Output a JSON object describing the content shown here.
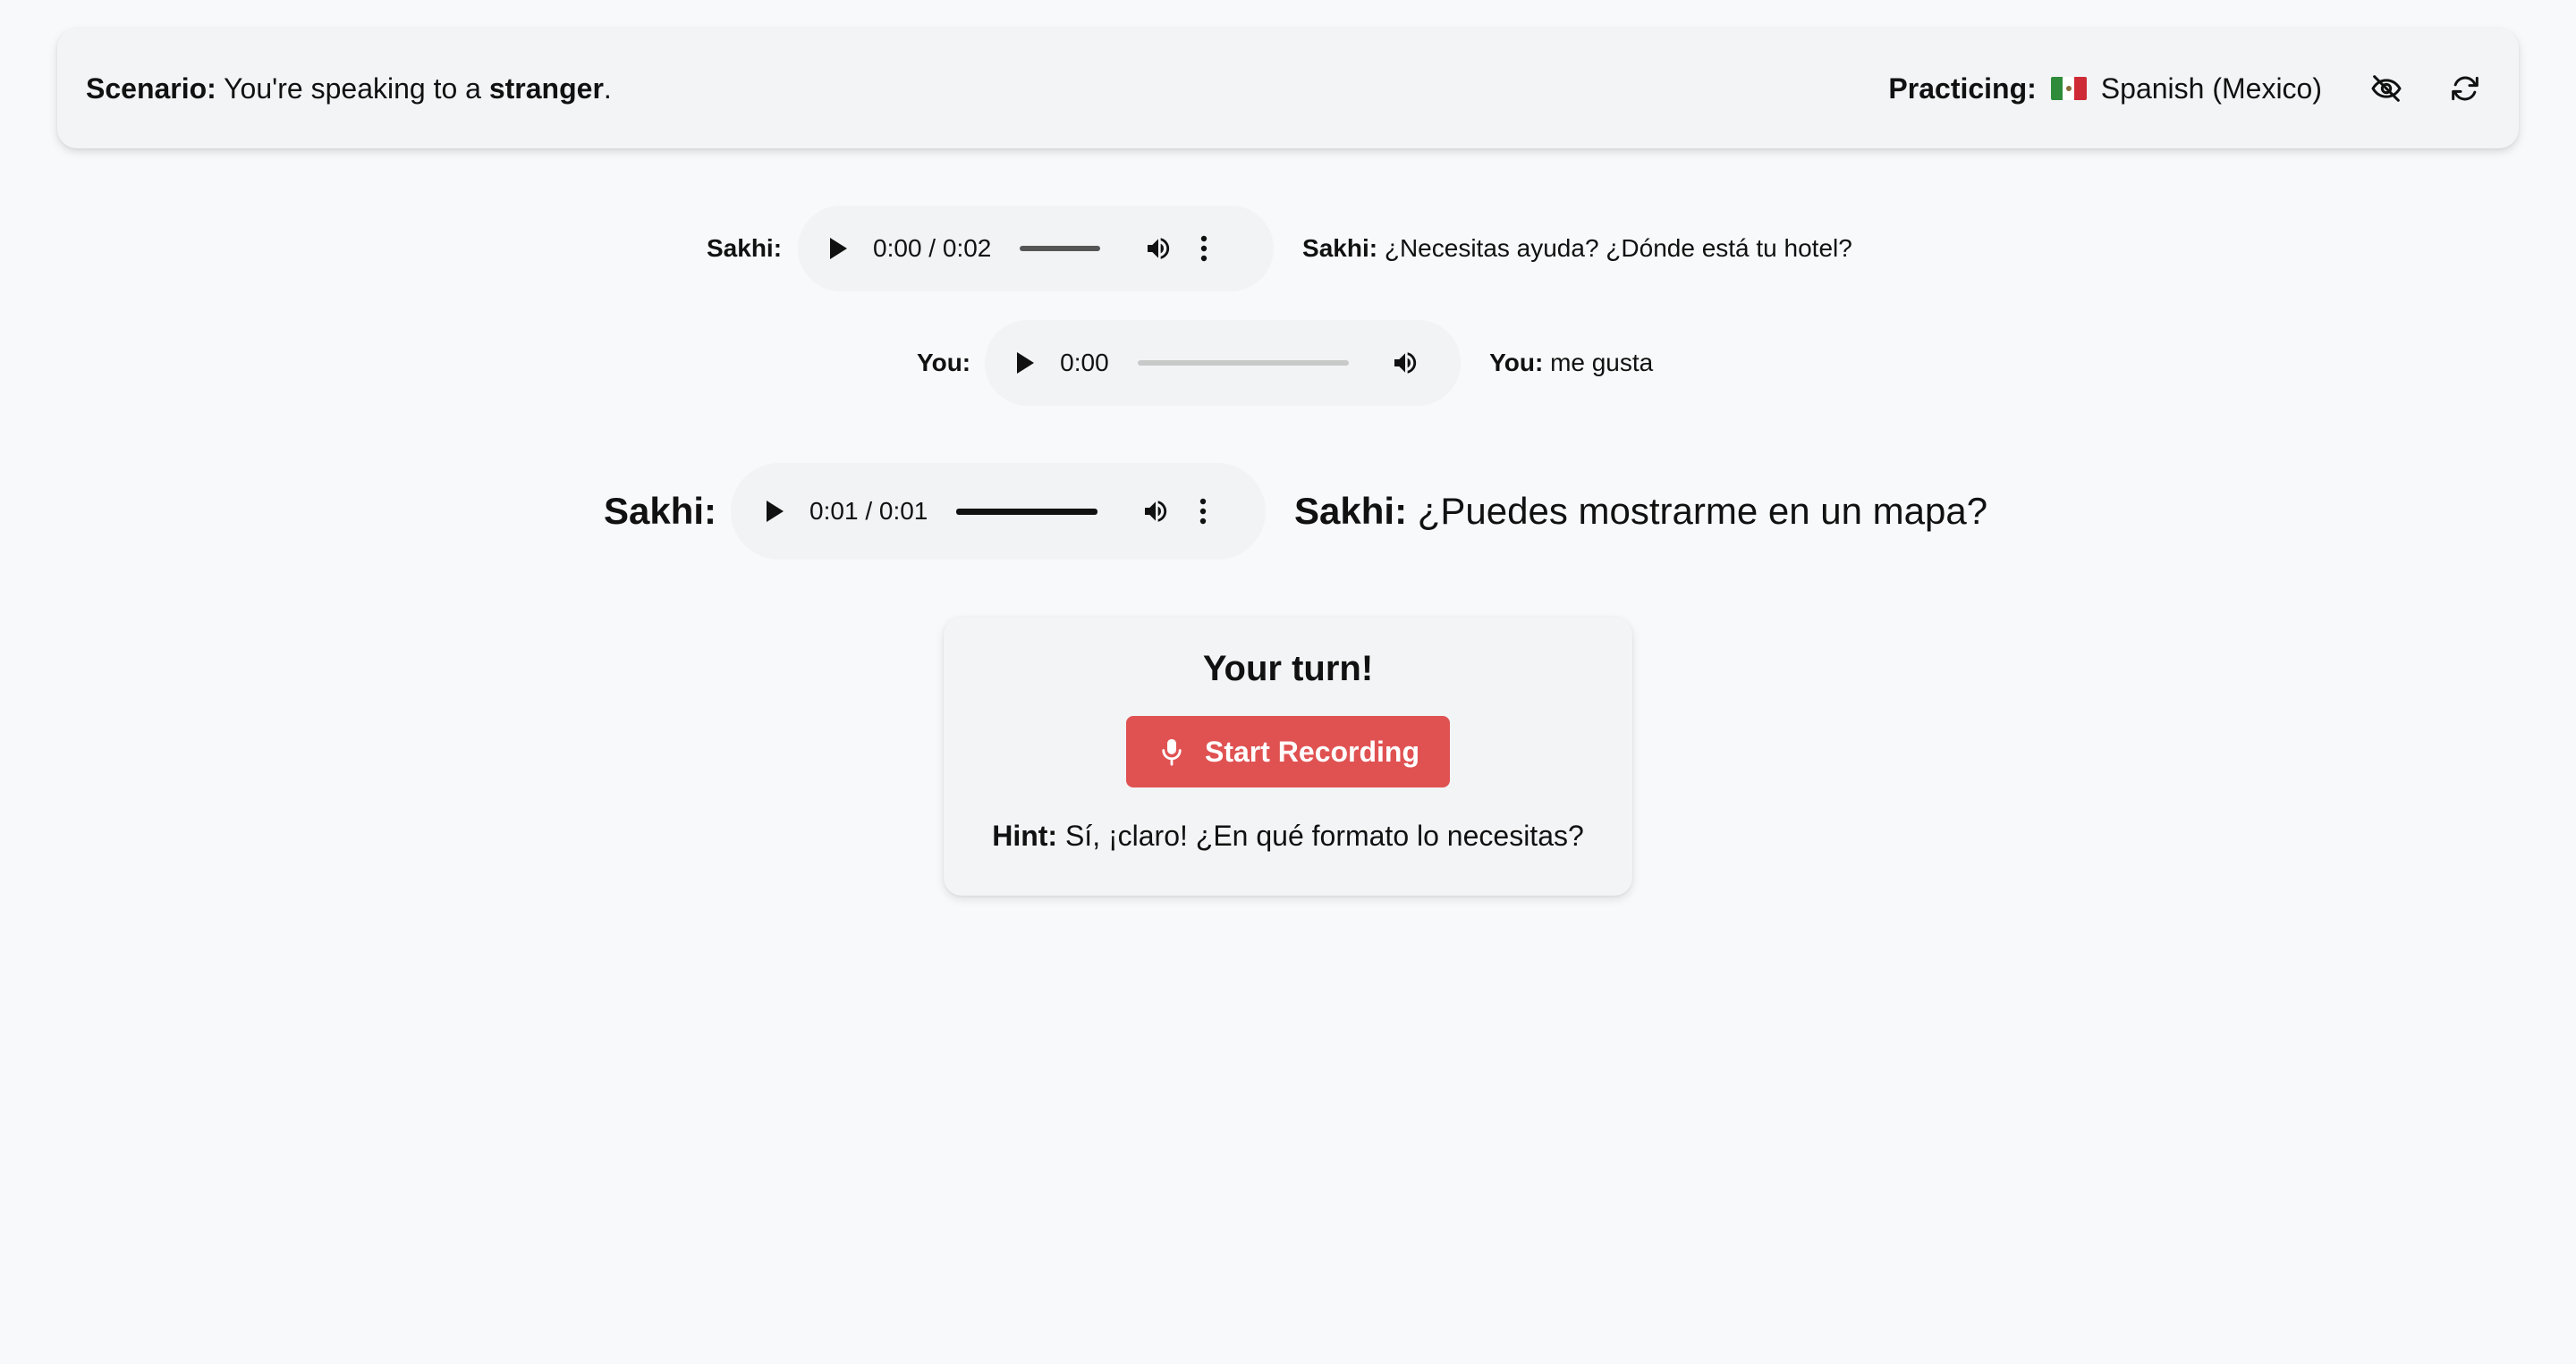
{
  "header": {
    "scenario_label": "Scenario:",
    "scenario_pre": "You're speaking to a",
    "scenario_target": "stranger",
    "scenario_post": ".",
    "practicing_label": "Practicing:",
    "language": "Spanish (Mexico)",
    "flag_colors": [
      "#2e8b3a",
      "#ffffff",
      "#ce2b37"
    ],
    "icons": [
      "eye-off-icon",
      "refresh-icon"
    ]
  },
  "conversation": [
    {
      "speaker": "Sakhi:",
      "time": "0:00 / 0:02",
      "transcript_speaker": "Sakhi:",
      "transcript": "¿Necesitas ayuda? ¿Dónde está tu hotel?"
    },
    {
      "speaker": "You:",
      "time": "0:00",
      "transcript_speaker": "You:",
      "transcript": "me gusta"
    },
    {
      "speaker": "Sakhi:",
      "time": "0:01 / 0:01",
      "transcript_speaker": "Sakhi:",
      "transcript": "¿Puedes mostrarme en un mapa?"
    }
  ],
  "turn": {
    "title": "Your turn!",
    "record_label": "Start Recording",
    "record_color": "#e05252",
    "hint_label": "Hint:",
    "hint_text": "Sí, ¡claro! ¿En qué formato lo necesitas?"
  }
}
